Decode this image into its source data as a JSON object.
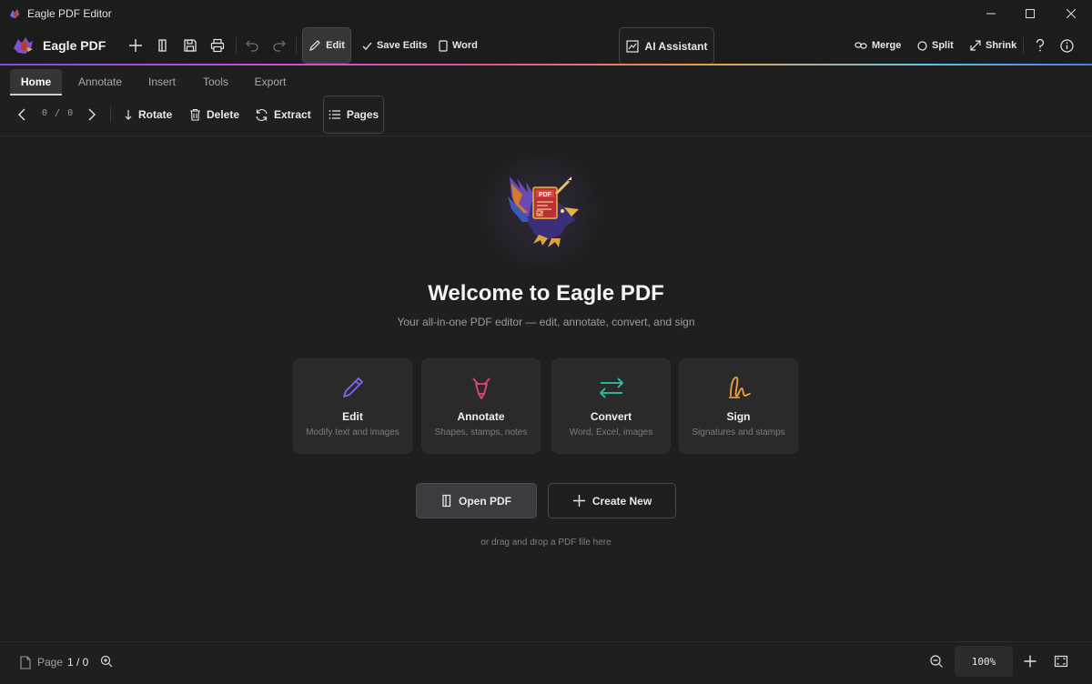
{
  "window": {
    "title": "Eagle PDF Editor"
  },
  "toolbar": {
    "brand": "Eagle PDF",
    "edit_label": "Edit",
    "save_edits_label": "Save Edits",
    "word_label": "Word",
    "ai_assistant_label": "AI Assistant",
    "merge_label": "Merge",
    "split_label": "Split",
    "shrink_label": "Shrink"
  },
  "tabs": [
    {
      "label": "Home",
      "active": true
    },
    {
      "label": "Annotate",
      "active": false
    },
    {
      "label": "Insert",
      "active": false
    },
    {
      "label": "Tools",
      "active": false
    },
    {
      "label": "Export",
      "active": false
    }
  ],
  "subtoolbar": {
    "page_counter": "0 / 0",
    "rotate_label": "Rotate",
    "delete_label": "Delete",
    "extract_label": "Extract",
    "pages_label": "Pages"
  },
  "welcome": {
    "title": "Welcome to Eagle PDF",
    "subtitle": "Your all-in-one PDF editor — edit, annotate, convert, and sign",
    "logo_text": "PDF",
    "cards": [
      {
        "title": "Edit",
        "desc": "Modify text and images",
        "icon": "pencil-icon",
        "color": "#8a63f0"
      },
      {
        "title": "Annotate",
        "desc": "Shapes, stamps, notes",
        "icon": "highlighter-icon",
        "color": "#e0457b"
      },
      {
        "title": "Convert",
        "desc": "Word, Excel, images",
        "icon": "swap-arrows-icon",
        "color": "#2cc4a8"
      },
      {
        "title": "Sign",
        "desc": "Signatures and stamps",
        "icon": "signature-icon",
        "color": "#f0a53a"
      }
    ],
    "open_label": "Open PDF",
    "create_label": "Create New",
    "drop_hint": "or drag and drop a PDF file here"
  },
  "statusbar": {
    "page_label": "Page",
    "page_value": "1 / 0",
    "zoom": "100%"
  }
}
